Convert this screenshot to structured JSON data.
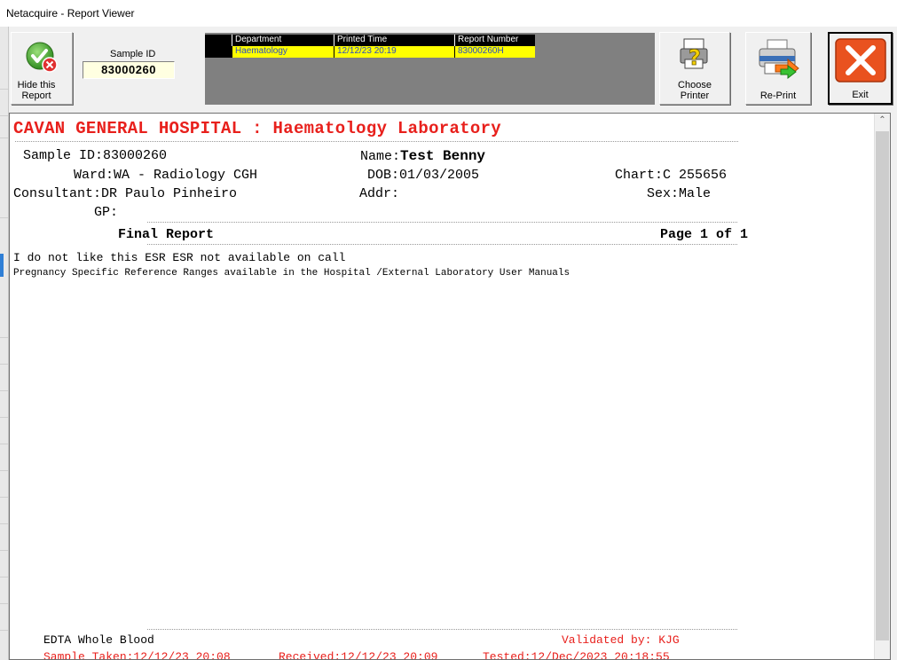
{
  "window": {
    "title": "Netacquire - Report Viewer"
  },
  "toolbar": {
    "hide_label_1": "Hide this",
    "hide_label_2": "Report",
    "sample_id_label": "Sample ID",
    "sample_id_value": "83000260",
    "choose_label_1": "Choose",
    "choose_label_2": "Printer",
    "reprint_label": "Re-Print",
    "exit_label": "Exit"
  },
  "report_grid": {
    "headers": [
      "Department",
      "Printed Time",
      "Report Number"
    ],
    "row": [
      "Haematology",
      "12/12/23 20:19",
      "83000260H"
    ]
  },
  "report": {
    "hospital_title": "CAVAN GENERAL HOSPITAL : Haematology Laboratory",
    "sample_id": "Sample ID:83000260",
    "name_label": "Name:",
    "name_value": "Test Benny",
    "ward": "Ward:WA - Radiology CGH",
    "dob": "DOB:01/03/2005",
    "chart": "Chart:C 255656",
    "consultant": "Consultant:DR Paulo Pinheiro",
    "addr": "Addr:",
    "sex": "Sex:Male",
    "gp": "GP:",
    "final_report": "Final Report",
    "page": "Page 1 of 1",
    "comment_1": "I do not like this ESR ESR not available on call",
    "comment_2": "Pregnancy Specific Reference Ranges available in the Hospital /External Laboratory User Manuals",
    "specimen": "EDTA Whole Blood",
    "validated": "Validated by: KJG",
    "sample_taken": "Sample Taken:12/12/23 20:08",
    "received": "Received:12/12/23 20:09",
    "tested": "Tested:12/Dec/2023 20:18:55"
  }
}
